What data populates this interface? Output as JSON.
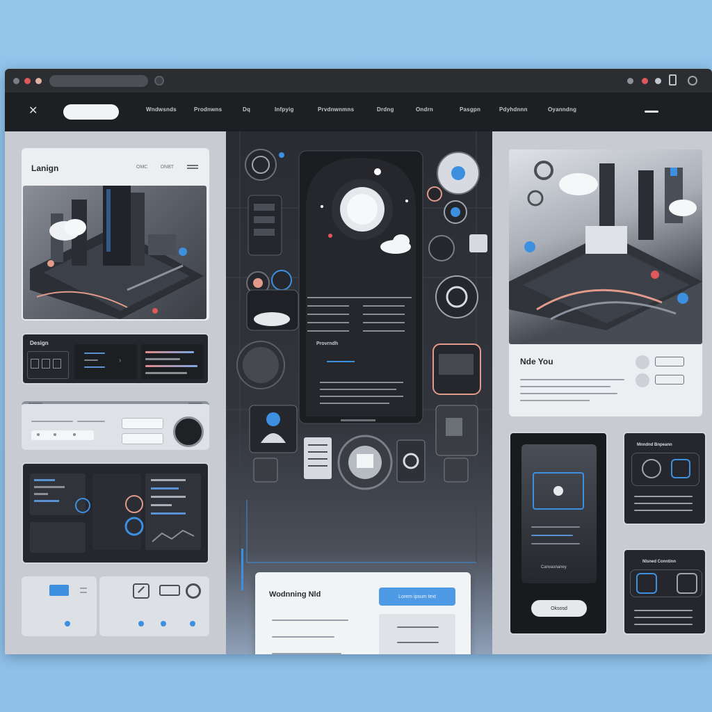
{
  "nav": {
    "search_placeholder": "",
    "items": [
      "Wndwsnds",
      "Prodnwns",
      "Dq",
      "Infpyig",
      "Prvdnwnmns",
      "Drdng",
      "Ondrn",
      "Pasgpn",
      "Pdyhdnnn",
      "Oyanndng"
    ]
  },
  "left": {
    "hero_title": "Lanign",
    "hero_links": [
      "OMC",
      "DNBT"
    ],
    "design_label": "Design"
  },
  "center": {
    "panel_label": "Provrndh",
    "welcome_title": "Wodnning Nld",
    "welcome_button": "Lorem ipsum text"
  },
  "right": {
    "hero_title": "Nde You",
    "phone_label": "Canvasnaney",
    "phone_button": "Oksosd",
    "card1_title": "Mnndnd Bnpeann",
    "card2_title": "Nlsned Conntinn"
  },
  "colors": {
    "accent": "#3d8fe0",
    "dark_panel": "#25272c",
    "light_panel": "#eceef1"
  }
}
